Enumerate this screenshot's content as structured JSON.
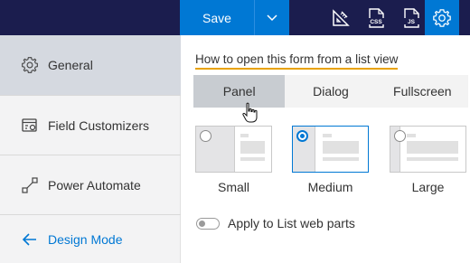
{
  "toolbar": {
    "save_label": "Save",
    "icons": [
      "ruler-icon",
      "css-file-icon",
      "js-file-icon",
      "gear-icon"
    ],
    "css_icon_text": "CSS",
    "js_icon_text": "JS"
  },
  "sidebar": {
    "items": [
      {
        "label": "General",
        "icon": "gear-icon",
        "selected": true
      },
      {
        "label": "Field Customizers",
        "icon": "field-customizer-icon",
        "selected": false
      },
      {
        "label": "Power Automate",
        "icon": "flow-icon",
        "selected": false
      },
      {
        "label": "Design Mode",
        "icon": "arrow-left-icon",
        "selected": false
      }
    ]
  },
  "main": {
    "section_title": "How to open this form from a list view",
    "open_modes": [
      {
        "label": "Panel",
        "active": true
      },
      {
        "label": "Dialog",
        "active": false
      },
      {
        "label": "Fullscreen",
        "active": false
      }
    ],
    "sizes": [
      {
        "label": "Small",
        "selected": false
      },
      {
        "label": "Medium",
        "selected": true
      },
      {
        "label": "Large",
        "selected": false
      }
    ],
    "apply_toggle": {
      "label": "Apply to List web parts",
      "on": false
    }
  },
  "colors": {
    "topbar": "#1b1d4e",
    "accent": "#0078d4",
    "underline": "#e8a200",
    "sidebar_bg": "#f3f3f4",
    "selected_nav": "#d5d9e0"
  }
}
